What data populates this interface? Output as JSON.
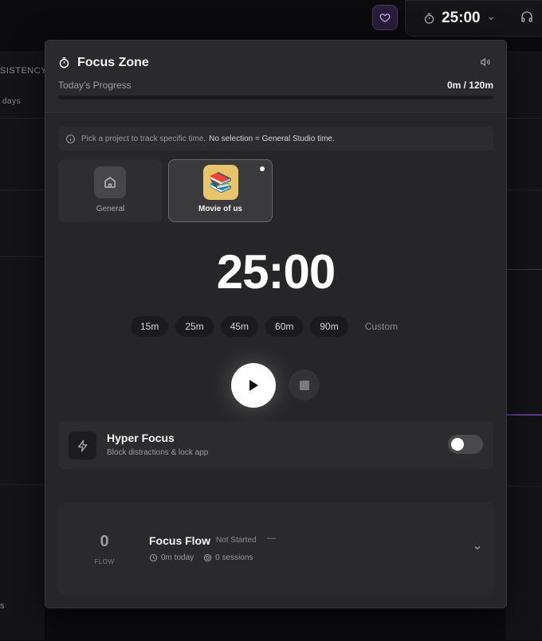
{
  "background": {
    "consistency_label": "SISTENCY",
    "days_label": "days",
    "bottom_label": "s"
  },
  "topbar": {
    "heart_icon": "heart-icon",
    "timer_value": "25:00",
    "headphones_icon": "headphones-icon"
  },
  "modal": {
    "title": "Focus Zone",
    "progress_label": "Today's Progress",
    "progress_value": "0m / 120m",
    "progress_fraction": 0,
    "info_text": "Pick a project to track specific time.",
    "info_strong": "No selection = General Studio time.",
    "projects": [
      {
        "label": "General",
        "icon": "home-icon",
        "selected": false
      },
      {
        "label": "Movie of us",
        "icon": "books-emoji",
        "emoji": "📚",
        "selected": true
      }
    ],
    "timer": "25:00",
    "presets": [
      "15m",
      "25m",
      "45m",
      "60m",
      "90m"
    ],
    "custom_label": "Custom",
    "hyper_focus": {
      "title": "Hyper Focus",
      "subtitle": "Block distractions & lock app",
      "enabled": false
    },
    "flow": {
      "count": "0",
      "unit": "FLOW",
      "title": "Focus Flow",
      "status": "Not Started",
      "dash": "—",
      "today": "0m today",
      "sessions": "0 sessions"
    }
  },
  "colors": {
    "accent_purple": "#4a3566",
    "movie_icon_bg": "#e8c56a",
    "modal_bg": "#262628"
  }
}
